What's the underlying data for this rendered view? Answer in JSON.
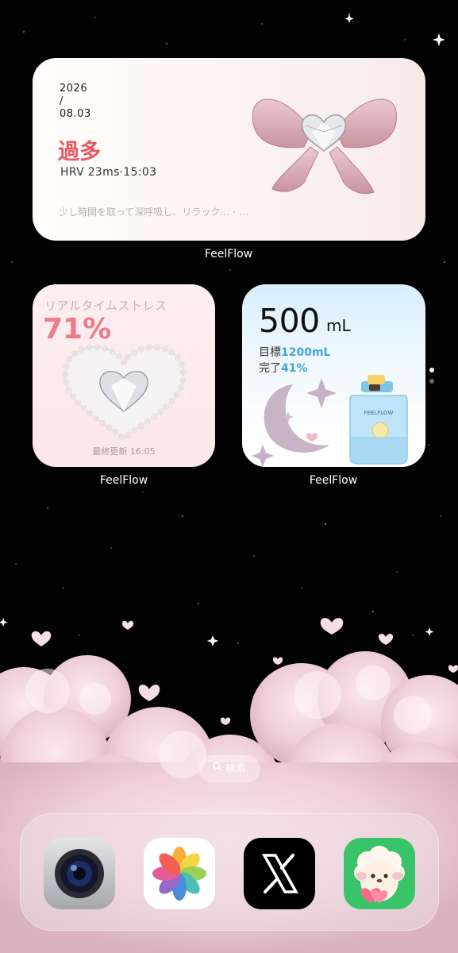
{
  "widgets": {
    "stress_summary": {
      "year": "2026",
      "separator": "/",
      "month_day": "08.03",
      "level": "過多",
      "hrv_line": "HRV 23ms·15:03",
      "advice": "少し時間を取って深呼吸し、リラック… · …",
      "app_label": "FeelFlow"
    },
    "realtime_stress": {
      "title": "リアルタイムストレス",
      "percent": "71%",
      "updated": "最終更新 16:05",
      "app_label": "FeelFlow"
    },
    "water": {
      "amount": "500",
      "unit": "mL",
      "goal_label": "目標",
      "goal_value": "1200mL",
      "done_label": "完了",
      "done_value": "41%",
      "bottle_brand": "FEELFLOW",
      "app_label": "FeelFlow"
    }
  },
  "search": {
    "label": "検索",
    "icon": "search-icon"
  },
  "dock": {
    "apps": [
      {
        "name": "camera",
        "icon": "camera-icon"
      },
      {
        "name": "photos",
        "icon": "photos-icon"
      },
      {
        "name": "x",
        "icon": "x-logo-icon"
      },
      {
        "name": "sheep-app",
        "icon": "sheep-icon"
      }
    ]
  },
  "page_indicator": {
    "count": 2,
    "current": 1
  },
  "colors": {
    "stress_level": "#e35a62",
    "stress_percent": "#ee7b8a",
    "water_highlight": "#3fa6d8",
    "dock_glass": "#ecdce2",
    "background": "#030303"
  }
}
